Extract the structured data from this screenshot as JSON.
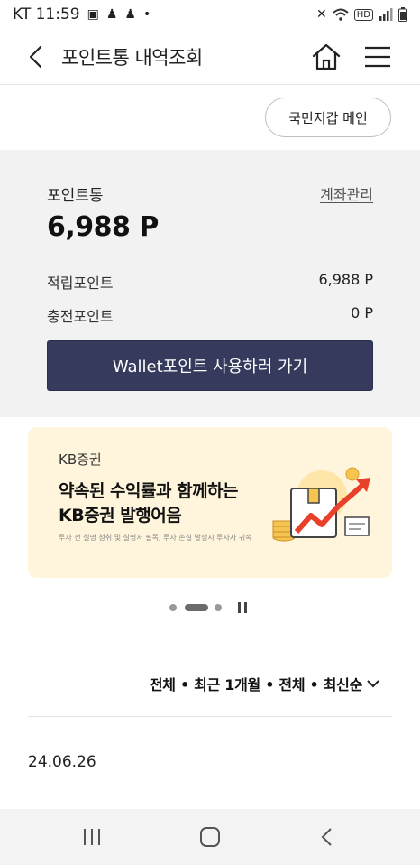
{
  "status_bar": {
    "carrier_time": "KT 11:59",
    "left_icons": [
      "image-icon",
      "notification-icon",
      "notification-icon",
      "dot-icon"
    ],
    "right_icons": [
      "mute-icon",
      "wifi-icon",
      "hd-icon",
      "signal-icon",
      "battery-icon"
    ],
    "hd_label": "HD"
  },
  "header": {
    "title": "포인트통 내역조회"
  },
  "wallet_main_label": "국민지갑 메인",
  "summary": {
    "label": "포인트통",
    "account_link": "계좌관리",
    "total": "6,988 P",
    "rows": [
      {
        "label": "적립포인트",
        "value": "6,988 P"
      },
      {
        "label": "충전포인트",
        "value": "0 P"
      }
    ],
    "button": "Wallet포인트 사용하러 가기"
  },
  "banner": {
    "brand": "KB증권",
    "title_line1": "약속된 수익률과 함께하는",
    "title_line2": "KB증권 발행어음",
    "note": "투자 전 설명 청취 및 설명서 필독, 투자 손실 발생시 투자자 귀속",
    "colors": {
      "background": "#fff5dc",
      "accent": "#e8402a"
    }
  },
  "carousel": {
    "pages": 3,
    "active_page": 2
  },
  "filter": {
    "label": "전체 • 최근 1개월 • 전체 • 최신순"
  },
  "list": {
    "date": "24.06.26"
  },
  "colors": {
    "primary_button": "#363b5e",
    "summary_bg": "#f2f2f2",
    "positive_amount": "#2a7bd8"
  }
}
